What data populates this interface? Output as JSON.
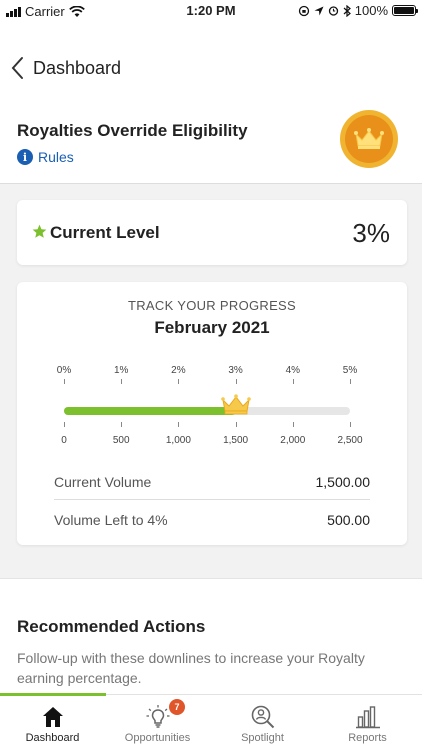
{
  "status_bar": {
    "carrier": "Carrier",
    "time": "1:20 PM",
    "battery": "100%"
  },
  "nav": {
    "back_label": "Dashboard"
  },
  "eligibility": {
    "title": "Royalties Override Eligibility",
    "rules_label": "Rules"
  },
  "current_level": {
    "label": "Current Level",
    "value": "3%"
  },
  "progress": {
    "heading": "TRACK YOUR PROGRESS",
    "month": "February 2021",
    "percent_labels": [
      "0%",
      "1%",
      "2%",
      "3%",
      "4%",
      "5%"
    ],
    "volume_labels": [
      "0",
      "500",
      "1,000",
      "1,500",
      "2,000",
      "2,500"
    ],
    "volume_min": 0,
    "volume_max": 2500,
    "current_volume_value": 1500,
    "current_volume_label": "Current Volume",
    "current_volume": "1,500.00",
    "volume_left_label": "Volume Left to 4%",
    "volume_left": "500.00"
  },
  "recommended": {
    "title": "Recommended Actions",
    "description": "Follow-up with these downlines to increase your Royalty earning percentage."
  },
  "tabs": [
    {
      "label": "Dashboard",
      "icon": "home-icon",
      "active": true
    },
    {
      "label": "Opportunities",
      "icon": "lightbulb-icon",
      "badge": "7"
    },
    {
      "label": "Spotlight",
      "icon": "spotlight-icon"
    },
    {
      "label": "Reports",
      "icon": "bar-chart-icon"
    }
  ],
  "colors": {
    "accent_green": "#7cc02e",
    "link_blue": "#1a5fb4",
    "badge_orange": "#e8901a",
    "badge_gold": "#f0b430",
    "notification_red": "#e0552a"
  }
}
